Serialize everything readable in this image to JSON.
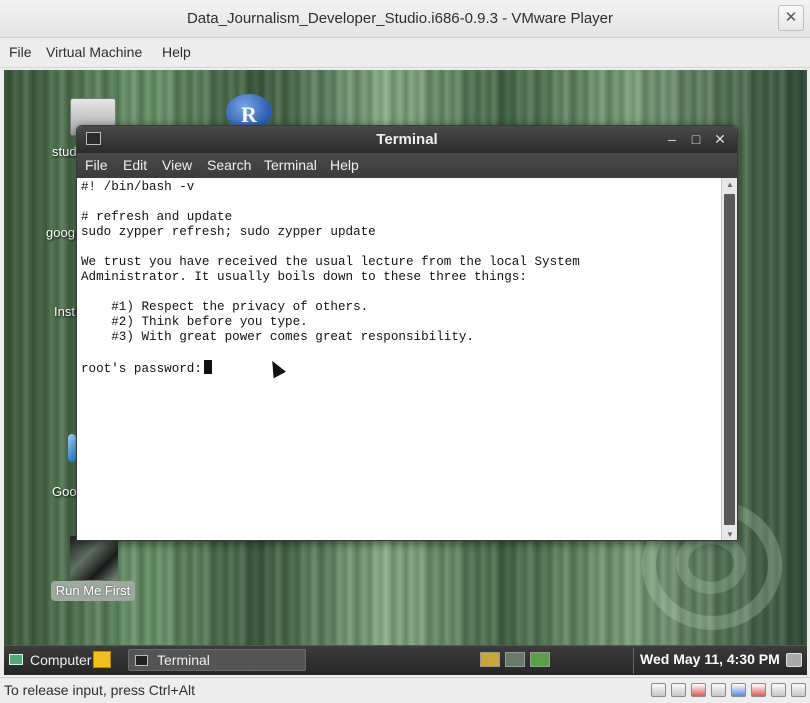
{
  "vm": {
    "title": "Data_Journalism_Developer_Studio.i686-0.9.3 - VMware Player",
    "close_glyph": "✕",
    "menu": [
      "File",
      "Virtual Machine",
      "Help"
    ]
  },
  "desktop": {
    "icons": [
      {
        "label": "stud",
        "icon": "folder-icon"
      },
      {
        "label": "goog",
        "icon": "google-icon"
      },
      {
        "label": "Inst",
        "icon": "install-icon"
      },
      {
        "label": "Goo",
        "icon": "google-drive-icon"
      },
      {
        "label": "Run Me First",
        "icon": "chess-icon"
      }
    ],
    "r_logo_text": "R"
  },
  "terminal": {
    "title": "Terminal",
    "buttons": {
      "minimize": "–",
      "maximize": "□",
      "close": "✕"
    },
    "menu": [
      "File",
      "Edit",
      "View",
      "Search",
      "Terminal",
      "Help"
    ],
    "lines": [
      "#! /bin/bash -v",
      "",
      "# refresh and update",
      "sudo zypper refresh; sudo zypper update",
      "",
      "We trust you have received the usual lecture from the local System",
      "Administrator. It usually boils down to these three things:",
      "",
      "    #1) Respect the privacy of others.",
      "    #2) Think before you type.",
      "    #3) With great power comes great responsibility.",
      "",
      "root's password:"
    ]
  },
  "taskbar": {
    "computer_label": "Computer",
    "task_label": "Terminal",
    "clock": "Wed May 11,  4:30 PM"
  },
  "statusbar": {
    "text": "To release input, press Ctrl+Alt"
  }
}
